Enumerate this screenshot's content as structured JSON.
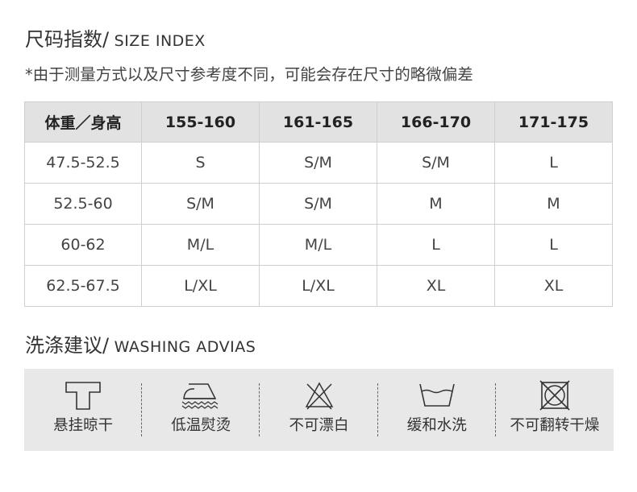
{
  "size_section": {
    "title_cn": "尺码指数/",
    "title_en": " SIZE INDEX",
    "note": "*由于测量方式以及尺寸参考度不同，可能会存在尺寸的略微偏差",
    "headers": [
      "体重／身高",
      "155-160",
      "161-165",
      "166-170",
      "171-175"
    ],
    "rows": [
      [
        "47.5-52.5",
        "S",
        "S/M",
        "S/M",
        "L"
      ],
      [
        "52.5-60",
        "S/M",
        "S/M",
        "M",
        "M"
      ],
      [
        "60-62",
        "M/L",
        "M/L",
        "L",
        "L"
      ],
      [
        "62.5-67.5",
        "L/XL",
        "L/XL",
        "XL",
        "XL"
      ]
    ]
  },
  "wash_section": {
    "title_cn": "洗涤建议/",
    "title_en": " WASHING  ADVIAS",
    "items": [
      {
        "icon": "hang-dry-icon",
        "label": "悬挂晾干"
      },
      {
        "icon": "low-temp-iron-icon",
        "label": "低温熨烫"
      },
      {
        "icon": "no-bleach-icon",
        "label": "不可漂白"
      },
      {
        "icon": "gentle-wash-icon",
        "label": "缓和水洗"
      },
      {
        "icon": "no-tumble-dry-icon",
        "label": "不可翻转干燥"
      }
    ]
  }
}
